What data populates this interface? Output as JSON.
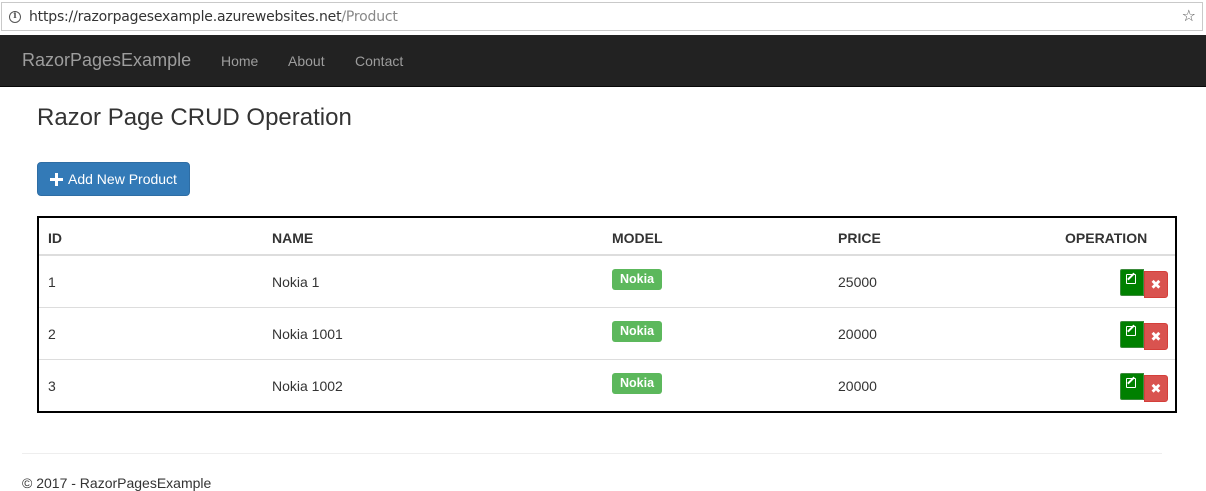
{
  "browser": {
    "url_host": "https://razorpagesexample.azurewebsites.net",
    "url_path": "/Product",
    "info_icon": "info-icon",
    "star_icon": "star-icon"
  },
  "navbar": {
    "brand": "RazorPagesExample",
    "links": [
      "Home",
      "About",
      "Contact"
    ]
  },
  "page": {
    "title": "Razor Page CRUD Operation",
    "add_button_label": "Add New Product"
  },
  "table": {
    "headers": [
      "ID",
      "NAME",
      "MODEL",
      "PRICE",
      "OPERATION"
    ],
    "rows": [
      {
        "id": "1",
        "name": "Nokia 1",
        "model": "Nokia",
        "price": "25000"
      },
      {
        "id": "2",
        "name": "Nokia 1001",
        "model": "Nokia",
        "price": "20000"
      },
      {
        "id": "3",
        "name": "Nokia 1002",
        "model": "Nokia",
        "price": "20000"
      }
    ],
    "delete_glyph": "✖"
  },
  "footer": {
    "text": "© 2017 - RazorPagesExample"
  },
  "colors": {
    "navbar_bg": "#222222",
    "primary": "#337ab7",
    "success_label": "#5cb85c",
    "edit_button": "#008000",
    "delete_button": "#d9534f"
  }
}
